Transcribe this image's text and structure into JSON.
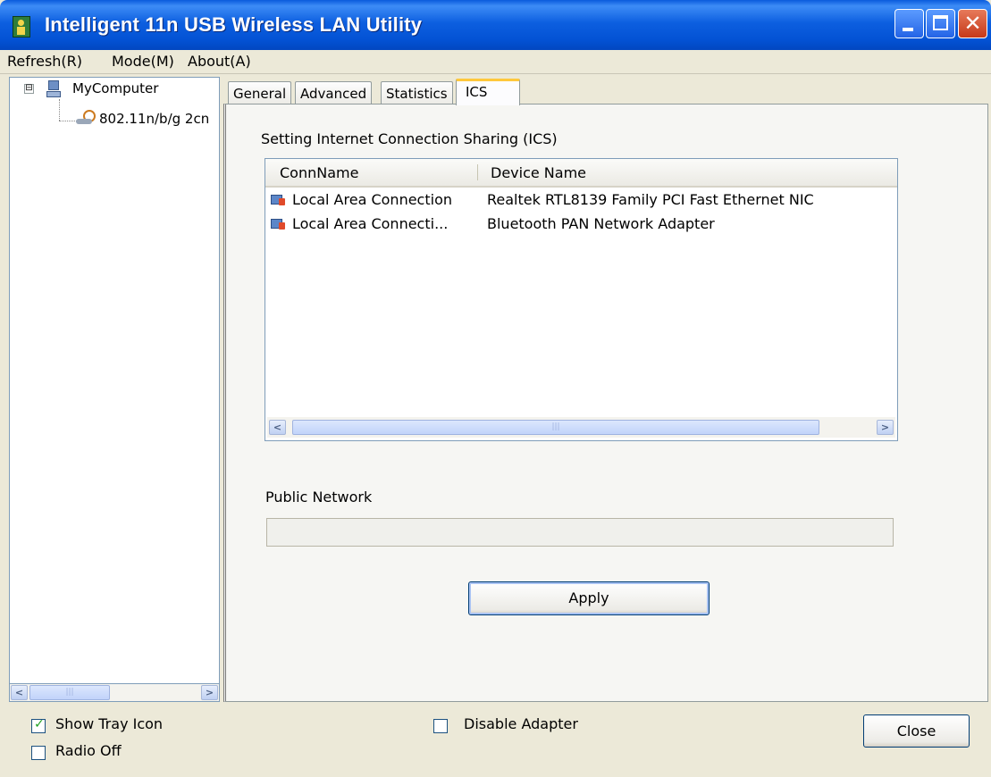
{
  "window": {
    "title": "Intelligent 11n USB Wireless LAN Utility"
  },
  "menu": {
    "items": [
      "Refresh(R)",
      "Mode(M)",
      "About(A)"
    ]
  },
  "tree": {
    "root_label": "MyComputer",
    "expander": "⊟",
    "adapter_label": "802.11n/b/g 2cn"
  },
  "tabs": [
    {
      "label": "General",
      "active": false
    },
    {
      "label": "Advanced",
      "active": false
    },
    {
      "label": "Statistics",
      "active": false
    },
    {
      "label": "ICS",
      "active": true
    }
  ],
  "ics": {
    "section_label": "Setting Internet Connection Sharing (ICS)",
    "columns": [
      "ConnName",
      "Device Name"
    ],
    "rows": [
      {
        "conn_name": "Local Area Connection",
        "device_name": "Realtek RTL8139 Family PCI Fast Ethernet NIC"
      },
      {
        "conn_name": "Local Area Connecti...",
        "device_name": "Bluetooth PAN Network Adapter"
      }
    ],
    "public_network_label": "Public Network",
    "public_network_value": "",
    "apply_label": "Apply"
  },
  "footer": {
    "show_tray_icon": {
      "label": "Show Tray Icon",
      "checked": true
    },
    "radio_off": {
      "label": "Radio Off",
      "checked": false
    },
    "disable_adapter": {
      "label": "Disable Adapter",
      "checked": false
    },
    "close_label": "Close"
  },
  "colors": {
    "titlebar": "#0a5bdc",
    "dialog_bg": "#ece9d8",
    "active_tab_accent": "#ffc83c"
  }
}
